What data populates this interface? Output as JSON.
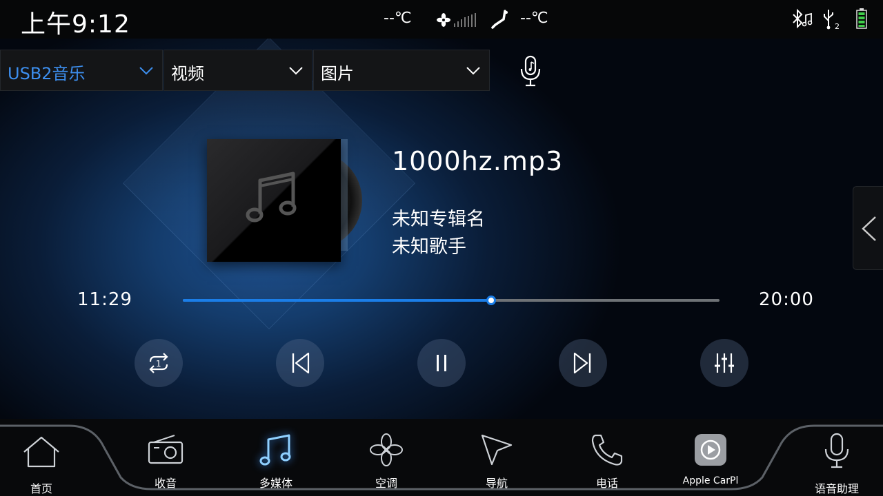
{
  "status": {
    "time": "上午9:12",
    "temp_left": "--℃",
    "temp_right": "--℃",
    "icons": [
      "fan-icon",
      "fan-level-bars-icon",
      "seat-icon",
      "bluetooth-music-icon",
      "usb-icon",
      "battery-icon"
    ],
    "usb_port": "2"
  },
  "sources": [
    {
      "label": "USB2音乐",
      "active": true
    },
    {
      "label": "视频",
      "active": false
    },
    {
      "label": "图片",
      "active": false
    }
  ],
  "track": {
    "title": "1000hz.mp3",
    "album": "未知专辑名",
    "artist": "未知歌手"
  },
  "progress": {
    "current": "11:29",
    "total": "20:00",
    "fraction": 0.574
  },
  "controls": [
    "repeat-one-icon",
    "previous-icon",
    "pause-icon",
    "next-icon",
    "equalizer-icon"
  ],
  "dock": {
    "items": [
      {
        "label": "首页",
        "icon": "home-icon"
      },
      {
        "label": "收音",
        "icon": "radio-icon"
      },
      {
        "label": "多媒体",
        "icon": "music-note-icon",
        "active": true
      },
      {
        "label": "空调",
        "icon": "fan-icon"
      },
      {
        "label": "导航",
        "icon": "navigation-arrow-icon"
      },
      {
        "label": "电话",
        "icon": "phone-icon"
      },
      {
        "label": "Apple CarPl",
        "icon": "carplay-icon"
      },
      {
        "label": "语音助理",
        "icon": "microphone-icon"
      }
    ]
  },
  "colors": {
    "accent": "#1b7ee8",
    "active_source": "#3d8fef",
    "background": "#000000"
  }
}
